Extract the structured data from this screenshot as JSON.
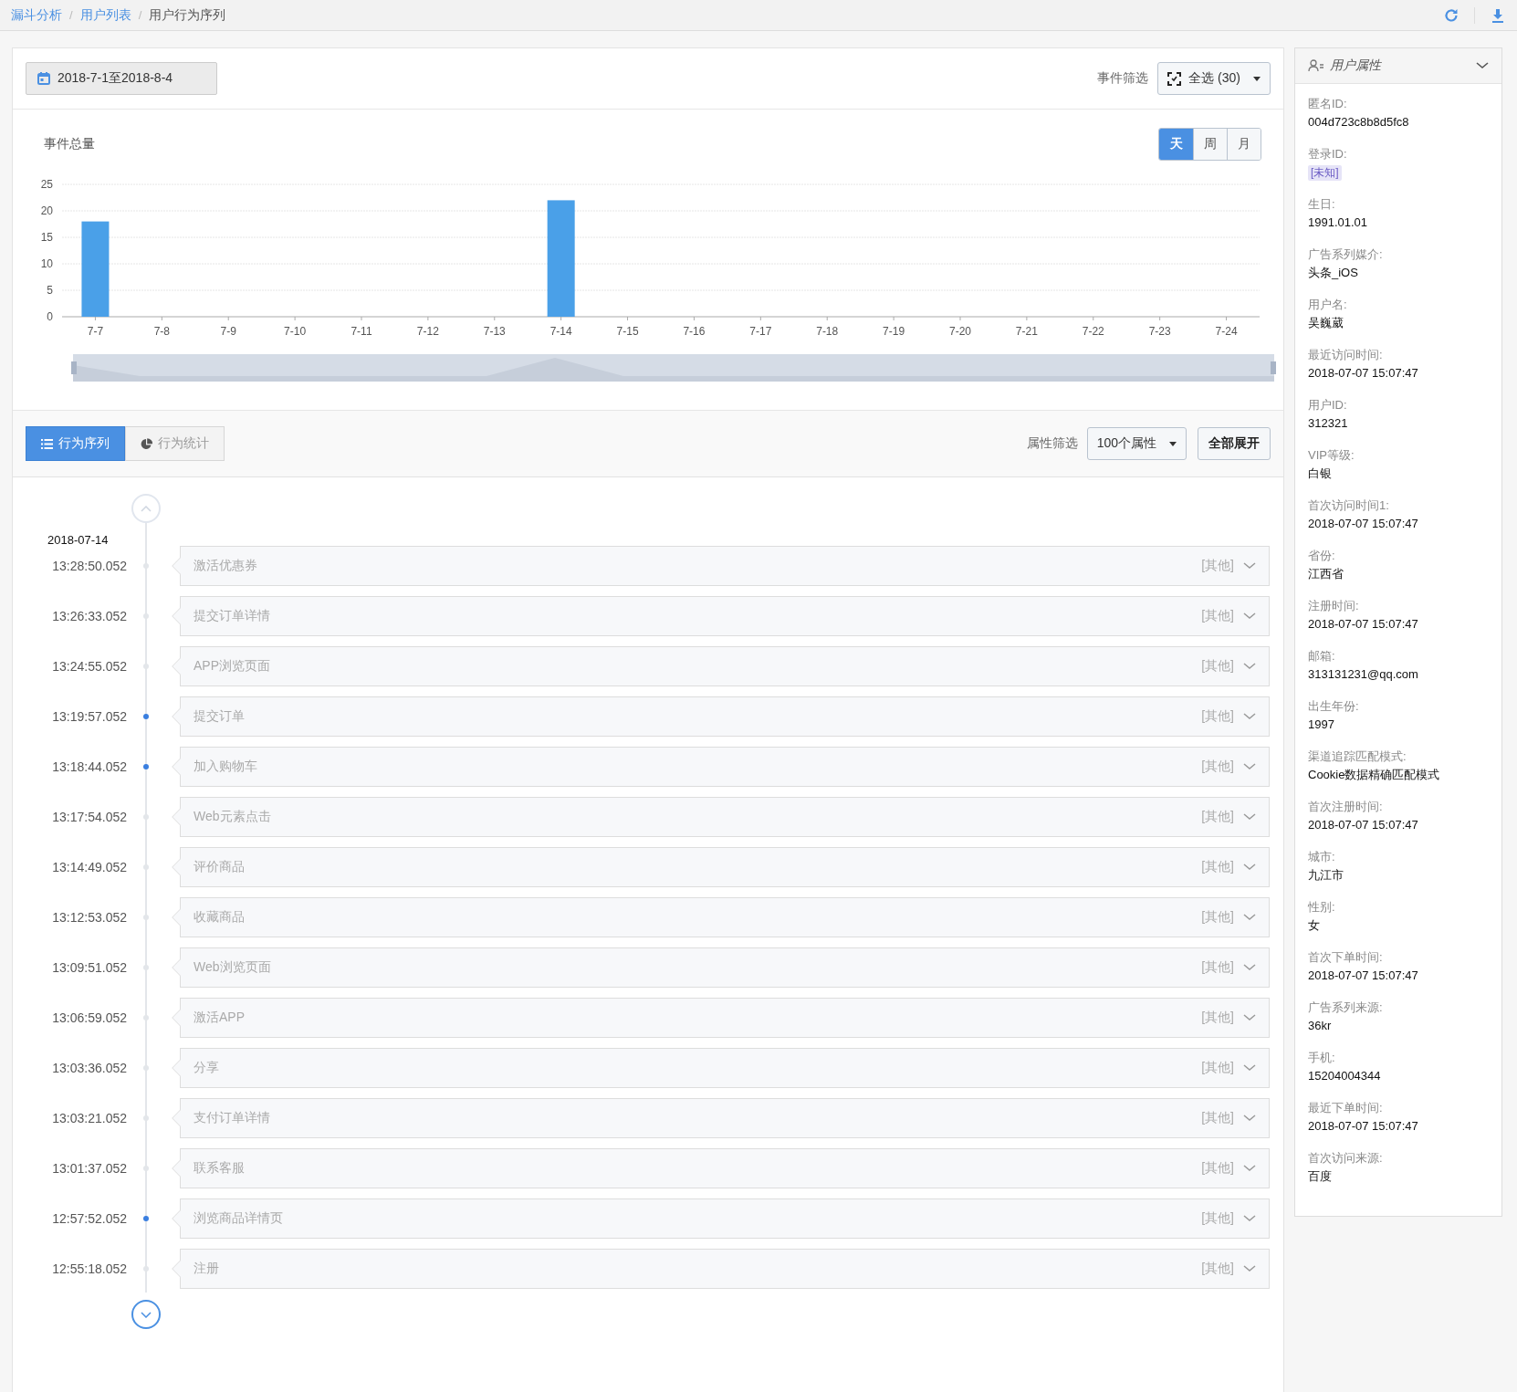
{
  "breadcrumb": {
    "separator": "/",
    "items": [
      {
        "label": "漏斗分析",
        "kind": "link"
      },
      {
        "label": "用户列表",
        "kind": "link"
      },
      {
        "label": "用户行为序列",
        "kind": "current"
      }
    ]
  },
  "filter_bar": {
    "date_range": "2018-7-1至2018-8-4",
    "event_filter_label": "事件筛选",
    "event_filter_value": "全选 (30)"
  },
  "chart_panel": {
    "title": "事件总量",
    "granularity": [
      {
        "label": "天",
        "selected": true
      },
      {
        "label": "周",
        "selected": false
      },
      {
        "label": "月",
        "selected": false
      }
    ],
    "chart_data": {
      "type": "bar",
      "categories": [
        "7-7",
        "7-8",
        "7-9",
        "7-10",
        "7-11",
        "7-12",
        "7-13",
        "7-14",
        "7-15",
        "7-16",
        "7-17",
        "7-18",
        "7-19",
        "7-20",
        "7-21",
        "7-22",
        "7-23",
        "7-24"
      ],
      "values": [
        18,
        0,
        0,
        0,
        0,
        0,
        0,
        22,
        0,
        0,
        0,
        0,
        0,
        0,
        0,
        0,
        0,
        0
      ],
      "ylim": [
        0,
        25
      ],
      "yticks": [
        0,
        5,
        10,
        15,
        20,
        25
      ],
      "grid": true
    }
  },
  "view_tabs": [
    {
      "label": "行为序列",
      "selected": true
    },
    {
      "label": "行为统计",
      "selected": false
    }
  ],
  "attribute_filter": {
    "label": "属性筛选",
    "value": "100个属性",
    "expand_button": "全部展开"
  },
  "timeline": {
    "date": "2018-07-14",
    "events": [
      {
        "time": "13:28:50.052",
        "name": "激活优惠券",
        "category": "[其他]",
        "marked": false
      },
      {
        "time": "13:26:33.052",
        "name": "提交订单详情",
        "category": "[其他]",
        "marked": false
      },
      {
        "time": "13:24:55.052",
        "name": "APP浏览页面",
        "category": "[其他]",
        "marked": false
      },
      {
        "time": "13:19:57.052",
        "name": "提交订单",
        "category": "[其他]",
        "marked": true
      },
      {
        "time": "13:18:44.052",
        "name": "加入购物车",
        "category": "[其他]",
        "marked": true
      },
      {
        "time": "13:17:54.052",
        "name": "Web元素点击",
        "category": "[其他]",
        "marked": false
      },
      {
        "time": "13:14:49.052",
        "name": "评价商品",
        "category": "[其他]",
        "marked": false
      },
      {
        "time": "13:12:53.052",
        "name": "收藏商品",
        "category": "[其他]",
        "marked": false
      },
      {
        "time": "13:09:51.052",
        "name": "Web浏览页面",
        "category": "[其他]",
        "marked": false
      },
      {
        "time": "13:06:59.052",
        "name": "激活APP",
        "category": "[其他]",
        "marked": false
      },
      {
        "time": "13:03:36.052",
        "name": "分享",
        "category": "[其他]",
        "marked": false
      },
      {
        "time": "13:03:21.052",
        "name": "支付订单详情",
        "category": "[其他]",
        "marked": false
      },
      {
        "time": "13:01:37.052",
        "name": "联系客服",
        "category": "[其他]",
        "marked": false
      },
      {
        "time": "12:57:52.052",
        "name": "浏览商品详情页",
        "category": "[其他]",
        "marked": true
      },
      {
        "time": "12:55:18.052",
        "name": "注册",
        "category": "[其他]",
        "marked": false
      }
    ]
  },
  "user_panel": {
    "title": "用户属性",
    "fields": [
      {
        "label": "匿名ID:",
        "value": "004d723c8b8d5fc8",
        "kind": "text"
      },
      {
        "label": "登录ID:",
        "value": "[未知]",
        "kind": "tag"
      },
      {
        "label": "生日:",
        "value": "1991.01.01",
        "kind": "text"
      },
      {
        "label": "广告系列媒介:",
        "value": "头条_iOS",
        "kind": "text"
      },
      {
        "label": "用户名:",
        "value": "吴巍葳",
        "kind": "text"
      },
      {
        "label": "最近访问时间:",
        "value": "2018-07-07 15:07:47",
        "kind": "text"
      },
      {
        "label": "用户ID:",
        "value": "312321",
        "kind": "text"
      },
      {
        "label": "VIP等级:",
        "value": "白银",
        "kind": "text"
      },
      {
        "label": "首次访问时间1:",
        "value": "2018-07-07 15:07:47",
        "kind": "text"
      },
      {
        "label": "省份:",
        "value": "江西省",
        "kind": "text"
      },
      {
        "label": "注册时间:",
        "value": "2018-07-07 15:07:47",
        "kind": "text"
      },
      {
        "label": "邮箱:",
        "value": "313131231@qq.com",
        "kind": "text"
      },
      {
        "label": "出生年份:",
        "value": "1997",
        "kind": "text"
      },
      {
        "label": "渠道追踪匹配模式:",
        "value": "Cookie数据精确匹配模式",
        "kind": "text"
      },
      {
        "label": "首次注册时间:",
        "value": "2018-07-07 15:07:47",
        "kind": "text"
      },
      {
        "label": "城市:",
        "value": "九江市",
        "kind": "text"
      },
      {
        "label": "性别:",
        "value": "女",
        "kind": "text"
      },
      {
        "label": "首次下单时间:",
        "value": "2018-07-07 15:07:47",
        "kind": "text"
      },
      {
        "label": "广告系列来源:",
        "value": "36kr",
        "kind": "text"
      },
      {
        "label": "手机:",
        "value": "15204004344",
        "kind": "text"
      },
      {
        "label": "最近下单时间:",
        "value": "2018-07-07 15:07:47",
        "kind": "text"
      },
      {
        "label": "首次访问来源:",
        "value": "百度",
        "kind": "text"
      }
    ]
  }
}
